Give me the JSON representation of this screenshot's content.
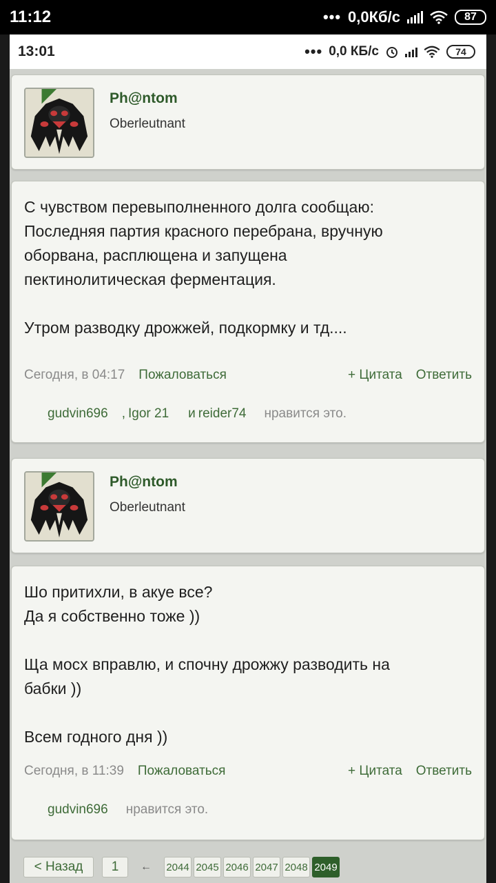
{
  "outer_status": {
    "time": "11:12",
    "dots": "•••",
    "speed": "0,0Кб/с",
    "battery": "87"
  },
  "inner_status": {
    "time": "13:01",
    "dots": "•••",
    "speed": "0,0 КБ/с",
    "battery": "74"
  },
  "posts": [
    {
      "author": "Ph@ntom",
      "rank": "Oberleutnant",
      "text": "С чувством перевыполненного долга сообщаю:\nПоследняя партия красного перебрана, вручную\nоборвана, расплющена и запущена\nпектинолитическая ферментация.\n\nУтром разводку дрожжей, подкормку и тд....",
      "date": "Сегодня, в 04:17",
      "report": "Пожаловаться",
      "quote": "+ Цитата",
      "reply": "Ответить",
      "likes": [
        "gudvin696",
        "Igor 21",
        "reider74"
      ],
      "like_sep1": ",",
      "like_sep2": "и",
      "likes_suffix": "нравится это."
    },
    {
      "author": "Ph@ntom",
      "rank": "Oberleutnant",
      "text": "Шо притихли, в акуе все?\nДа я собственно тоже ))\n\nЩа мосх вправлю, и спочну дрожжу разводить на\nбабки ))\n\nВсем годного дня ))",
      "date": "Сегодня, в 11:39",
      "report": "Пожаловаться",
      "quote": "+ Цитата",
      "reply": "Ответить",
      "likes": [
        "gudvin696"
      ],
      "likes_suffix": "нравится это."
    }
  ],
  "pager": {
    "back": "< Назад",
    "first": "1",
    "ellipsis_arrow": "←",
    "pages": [
      "2044",
      "2045",
      "2046",
      "2047",
      "2048",
      "2049"
    ],
    "current": "2049"
  },
  "colors": {
    "accent_green": "#3e6b38",
    "author_green": "#2e5a2a",
    "page_active": "#2e5f2a",
    "card_bg": "#f4f5f1",
    "screen_bg": "#cfd1cc"
  }
}
